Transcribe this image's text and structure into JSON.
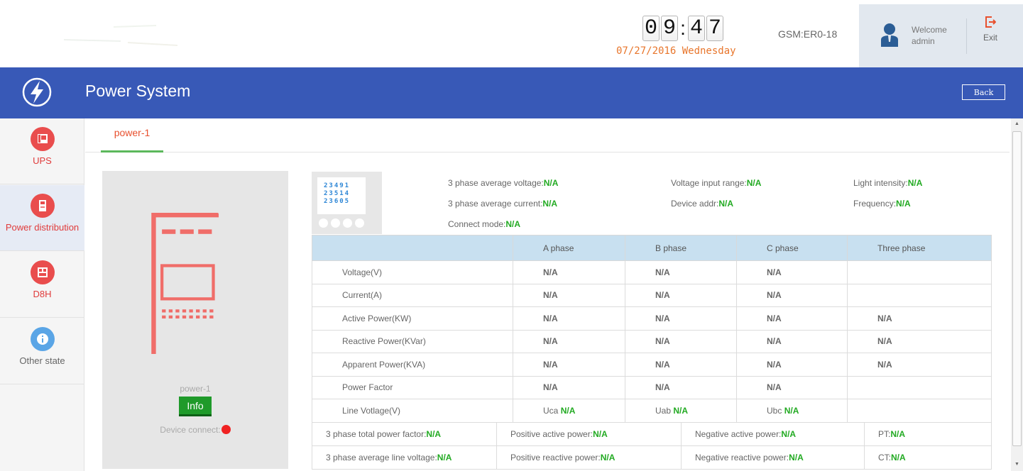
{
  "header": {
    "clock_digits": [
      "0",
      "9",
      "4",
      "7"
    ],
    "date": "07/27/2016 Wednesday",
    "gsm": "GSM:ER0-18",
    "welcome": "Welcome",
    "user": "admin",
    "exit_label": "Exit"
  },
  "titlebar": {
    "title": "Power System",
    "back_label": "Back"
  },
  "sidebar": {
    "items": [
      {
        "label": "UPS"
      },
      {
        "label": "Power distribution"
      },
      {
        "label": "D8H"
      },
      {
        "label": "Other state"
      }
    ]
  },
  "tabs": [
    {
      "label": "power-1"
    }
  ],
  "device": {
    "name": "power-1",
    "info_label": "Info",
    "connect_label": "Device connect:"
  },
  "meter_screen": [
    "23491",
    "23514",
    "23605"
  ],
  "summary": {
    "avg_voltage_label": "3 phase average voltage:",
    "avg_voltage": "N/A",
    "avg_current_label": "3 phase average current:",
    "avg_current": "N/A",
    "connect_mode_label": "Connect mode:",
    "connect_mode": "N/A",
    "voltage_range_label": "Voltage input range:",
    "voltage_range": "N/A",
    "device_addr_label": "Device addr:",
    "device_addr": "N/A",
    "light_label": "Light intensity:",
    "light": "N/A",
    "frequency_label": "Frequency:",
    "frequency": "N/A"
  },
  "table": {
    "headers": [
      "",
      "A phase",
      "B phase",
      "C phase",
      "Three phase"
    ],
    "rows": [
      {
        "label": "Voltage(V)",
        "a": "N/A",
        "b": "N/A",
        "c": "N/A",
        "t": ""
      },
      {
        "label": "Current(A)",
        "a": "N/A",
        "b": "N/A",
        "c": "N/A",
        "t": ""
      },
      {
        "label": "Active Power(KW)",
        "a": "N/A",
        "b": "N/A",
        "c": "N/A",
        "t": "N/A"
      },
      {
        "label": "Reactive Power(KVar)",
        "a": "N/A",
        "b": "N/A",
        "c": "N/A",
        "t": "N/A"
      },
      {
        "label": "Apparent Power(KVA)",
        "a": "N/A",
        "b": "N/A",
        "c": "N/A",
        "t": "N/A"
      },
      {
        "label": "Power Factor",
        "a": "N/A",
        "b": "N/A",
        "c": "N/A",
        "t": ""
      }
    ],
    "line_voltage": {
      "label": "Line Votlage(V)",
      "uca_label": "Uca",
      "uca": "N/A",
      "uab_label": "Uab",
      "uab": "N/A",
      "ubc_label": "Ubc",
      "ubc": "N/A"
    }
  },
  "bottom": {
    "row1": [
      {
        "label": "3 phase total power factor:",
        "value": "N/A"
      },
      {
        "label": "Positive active power:",
        "value": "N/A"
      },
      {
        "label": "Negative active power:",
        "value": "N/A"
      },
      {
        "label": "PT:",
        "value": "N/A"
      }
    ],
    "row2": [
      {
        "label": "3 phase average line voltage:",
        "value": "N/A"
      },
      {
        "label": "Positive reactive power:",
        "value": "N/A"
      },
      {
        "label": "Negative reactive power:",
        "value": "N/A"
      },
      {
        "label": "CT:",
        "value": "N/A"
      }
    ]
  },
  "colors": {
    "titlebar": "#3859b7",
    "accent_red": "#e94d4d",
    "value_green": "#22aa22",
    "date_orange": "#e8762c",
    "info_button": "#1f9a2a"
  },
  "icons": {
    "titlebar": "lightning-bolt-icon",
    "ups": "ups-icon",
    "power_distribution": "power-distribution-icon",
    "d8h": "d8h-icon",
    "other_state": "info-icon",
    "user": "user-icon",
    "exit": "exit-icon"
  }
}
